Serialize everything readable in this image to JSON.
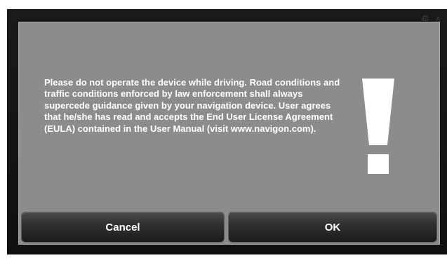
{
  "dialog": {
    "message": "Please do not operate the device while driving. Road conditions and traffic conditions enforced by law enforcement shall always supercede guidance given by your navigation device. User agrees that he/she has read and accepts the End User License Agreement (EULA) contained in the User Manual (visit www.navigon.com).",
    "icon": "exclamation-icon",
    "buttons": {
      "cancel_label": "Cancel",
      "ok_label": "OK"
    }
  },
  "colors": {
    "dialog_bg": "#8c8c8c",
    "screen_bg": "#141414",
    "text": "#ffffff"
  }
}
